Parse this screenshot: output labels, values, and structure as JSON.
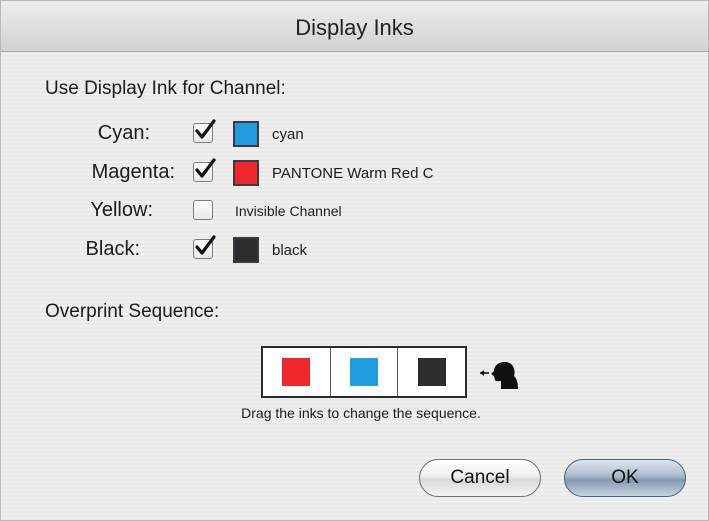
{
  "dialog": {
    "title": "Display Inks"
  },
  "channels_section": {
    "heading": "Use Display Ink for Channel:",
    "rows": [
      {
        "label": "Cyan:",
        "checked": true,
        "swatch_color": "#1f9be0",
        "ink_name": "cyan"
      },
      {
        "label": "Magenta:",
        "checked": true,
        "swatch_color": "#f0262d",
        "ink_name": "PANTONE Warm Red C"
      },
      {
        "label": "Yellow:",
        "checked": false,
        "swatch_color": null,
        "ink_name": "Invisible Channel"
      },
      {
        "label": "Black:",
        "checked": true,
        "swatch_color": "#2b2b30",
        "ink_name": "black"
      }
    ]
  },
  "overprint_section": {
    "heading": "Overprint Sequence:",
    "sequence_colors": [
      "#f0262d",
      "#1f9be0",
      "#2b2b30"
    ],
    "hint": "Drag the inks to change the sequence."
  },
  "buttons": {
    "cancel_label": "Cancel",
    "ok_label": "OK"
  },
  "icons": {
    "checkmark": "checkmark-icon",
    "viewer": "viewer-eye-icon"
  }
}
